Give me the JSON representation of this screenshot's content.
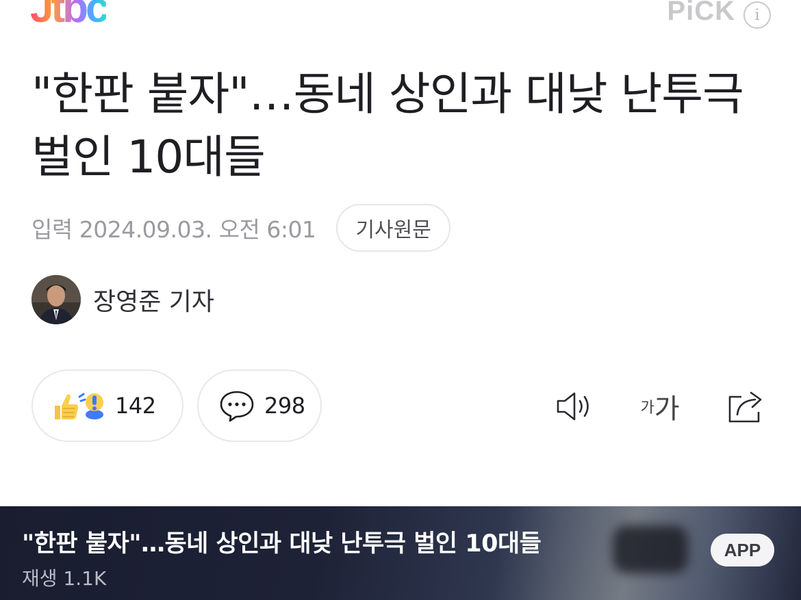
{
  "header": {
    "logo_text": "Jtbc",
    "pick_label": "PiCK",
    "info_label": "i"
  },
  "article": {
    "title": "\"한판 붙자\"…동네 상인과 대낮 난투극 벌인 10대들",
    "date": "입력 2024.09.03. 오전 6:01",
    "origin_button": "기사원문",
    "reporter_name": "장영준 기자"
  },
  "actions": {
    "reaction_count": "142",
    "comment_count": "298",
    "font_small": "가",
    "font_big": "가"
  },
  "banner": {
    "title": "\"한판 붙자\"…동네 상인과 대낮 난투극 벌인 10대들",
    "subtitle": "재생 1.1K",
    "app_button": "APP"
  },
  "colors": {
    "title": "#1e1e23",
    "meta_gray": "#9a9aa0",
    "banner_bg": "#242a42"
  }
}
